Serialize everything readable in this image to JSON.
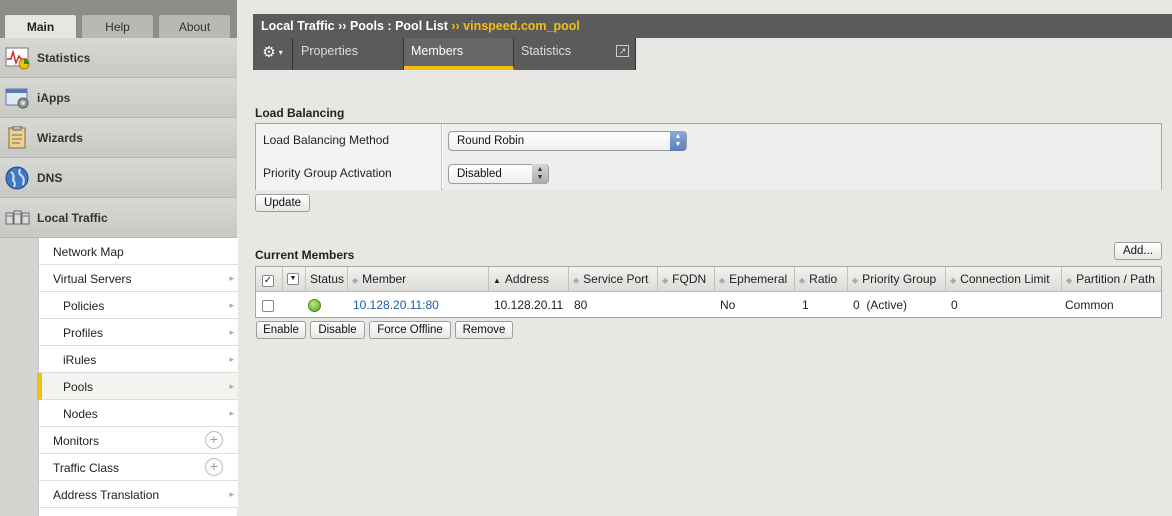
{
  "top_tabs": {
    "main": "Main",
    "help": "Help",
    "about": "About"
  },
  "nav": [
    {
      "label": "Statistics",
      "icon": "statistics-icon"
    },
    {
      "label": "iApps",
      "icon": "iapps-icon"
    },
    {
      "label": "Wizards",
      "icon": "wizards-icon"
    },
    {
      "label": "DNS",
      "icon": "dns-globe-icon"
    },
    {
      "label": "Local Traffic",
      "icon": "local-traffic-icon"
    }
  ],
  "subnav": [
    {
      "label": "Network Map"
    },
    {
      "label": "Virtual Servers"
    },
    {
      "label": "Policies"
    },
    {
      "label": "Profiles"
    },
    {
      "label": "iRules"
    },
    {
      "label": "Pools"
    },
    {
      "label": "Nodes"
    },
    {
      "label": "Monitors"
    },
    {
      "label": "Traffic Class"
    },
    {
      "label": "Address Translation"
    }
  ],
  "breadcrumb": {
    "part1": "Local Traffic",
    "sep1": "››",
    "part2": "Pools : Pool List",
    "sep2": "››",
    "current": "vinspeed.com_pool"
  },
  "subtabs": {
    "properties": "Properties",
    "members": "Members",
    "statistics": "Statistics"
  },
  "load_balancing": {
    "title": "Load Balancing",
    "method_label": "Load Balancing Method",
    "method_value": "Round Robin",
    "priority_label": "Priority Group Activation",
    "priority_value": "Disabled",
    "update_label": "Update"
  },
  "members": {
    "title": "Current Members",
    "add_label": "Add...",
    "columns": {
      "status": "Status",
      "member": "Member",
      "address": "Address",
      "service_port": "Service Port",
      "fqdn": "FQDN",
      "ephemeral": "Ephemeral",
      "ratio": "Ratio",
      "priority_group": "Priority Group",
      "connection_limit": "Connection Limit",
      "partition_path": "Partition / Path"
    },
    "rows": [
      {
        "member": "10.128.20.11:80",
        "address": "10.128.20.11",
        "service_port": "80",
        "fqdn": "",
        "ephemeral": "No",
        "ratio": "1",
        "priority_group": "0  (Active)",
        "connection_limit": "0",
        "partition_path": "Common",
        "status_color": "#6cc02a"
      }
    ],
    "actions": {
      "enable": "Enable",
      "disable": "Disable",
      "force_offline": "Force Offline",
      "remove": "Remove"
    }
  }
}
